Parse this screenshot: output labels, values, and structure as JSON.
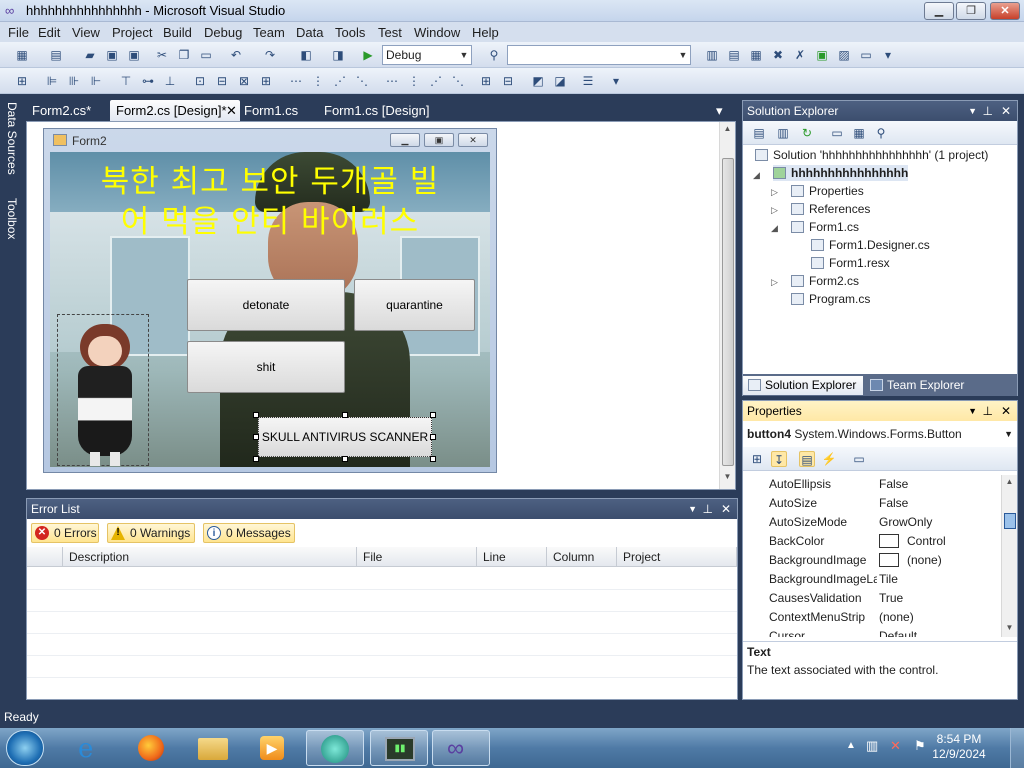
{
  "window": {
    "title": "hhhhhhhhhhhhhhhh - Microsoft Visual Studio",
    "minimize": "▁",
    "maximize": "❐",
    "close": "✕"
  },
  "menu": [
    "File",
    "Edit",
    "View",
    "Project",
    "Build",
    "Debug",
    "Team",
    "Data",
    "Tools",
    "Test",
    "Window",
    "Help"
  ],
  "toolbar": {
    "config": "Debug",
    "search": ""
  },
  "side_tabs": [
    "Data Sources",
    "Toolbox"
  ],
  "doc_tabs": [
    {
      "label": "Form2.cs*",
      "active": false
    },
    {
      "label": "Form2.cs [Design]*",
      "active": true
    },
    {
      "label": "Form1.cs",
      "active": false
    },
    {
      "label": "Form1.cs [Design]",
      "active": false
    }
  ],
  "form": {
    "title": "Form2",
    "headline_line1": "북한 최고 보안 두개골 빌",
    "headline_line2": "어 먹을 안티 바이러스",
    "buttons": {
      "detonate": "detonate",
      "quarantine": "quarantine",
      "shit": "shit",
      "scanner": "SKULL ANTIVIRUS SCANNER"
    }
  },
  "error_list": {
    "title": "Error List",
    "errors": "0 Errors",
    "warnings": "0 Warnings",
    "messages": "0 Messages",
    "columns": [
      "Description",
      "File",
      "Line",
      "Column",
      "Project"
    ]
  },
  "solution_explorer": {
    "title": "Solution Explorer",
    "tree": [
      {
        "label": "Solution 'hhhhhhhhhhhhhhhh' (1 project)",
        "icon": "solution-icon"
      },
      {
        "label": "hhhhhhhhhhhhhhhh",
        "icon": "project-icon",
        "bold": true
      },
      {
        "label": "Properties",
        "icon": "properties-icon"
      },
      {
        "label": "References",
        "icon": "references-icon"
      },
      {
        "label": "Form1.cs",
        "icon": "form-icon"
      },
      {
        "label": "Form1.Designer.cs",
        "icon": "cs-file-icon"
      },
      {
        "label": "Form1.resx",
        "icon": "resx-icon"
      },
      {
        "label": "Form2.cs",
        "icon": "form-icon"
      },
      {
        "label": "Program.cs",
        "icon": "cs-file-icon"
      }
    ],
    "tabs": [
      "Solution Explorer",
      "Team Explorer"
    ]
  },
  "properties": {
    "title": "Properties",
    "object_name": "button4",
    "object_type": "System.Windows.Forms.Button",
    "rows": [
      {
        "name": "AutoEllipsis",
        "value": "False"
      },
      {
        "name": "AutoSize",
        "value": "False"
      },
      {
        "name": "AutoSizeMode",
        "value": "GrowOnly"
      },
      {
        "name": "BackColor",
        "value": "Control",
        "swatch": true
      },
      {
        "name": "BackgroundImage",
        "value": "(none)",
        "swatch": true
      },
      {
        "name": "BackgroundImageLa",
        "value": "Tile"
      },
      {
        "name": "CausesValidation",
        "value": "True"
      },
      {
        "name": "ContextMenuStrip",
        "value": "(none)"
      },
      {
        "name": "Cursor",
        "value": "Default"
      }
    ],
    "desc_title": "Text",
    "desc_text": "The text associated with the control."
  },
  "status": "Ready",
  "clock": {
    "time": "8:54 PM",
    "date": "12/9/2024"
  },
  "colors": {
    "vs_blue": "#2b3c59",
    "headline_yellow": "#ffff00",
    "tab_active": "#ffe8a6"
  }
}
